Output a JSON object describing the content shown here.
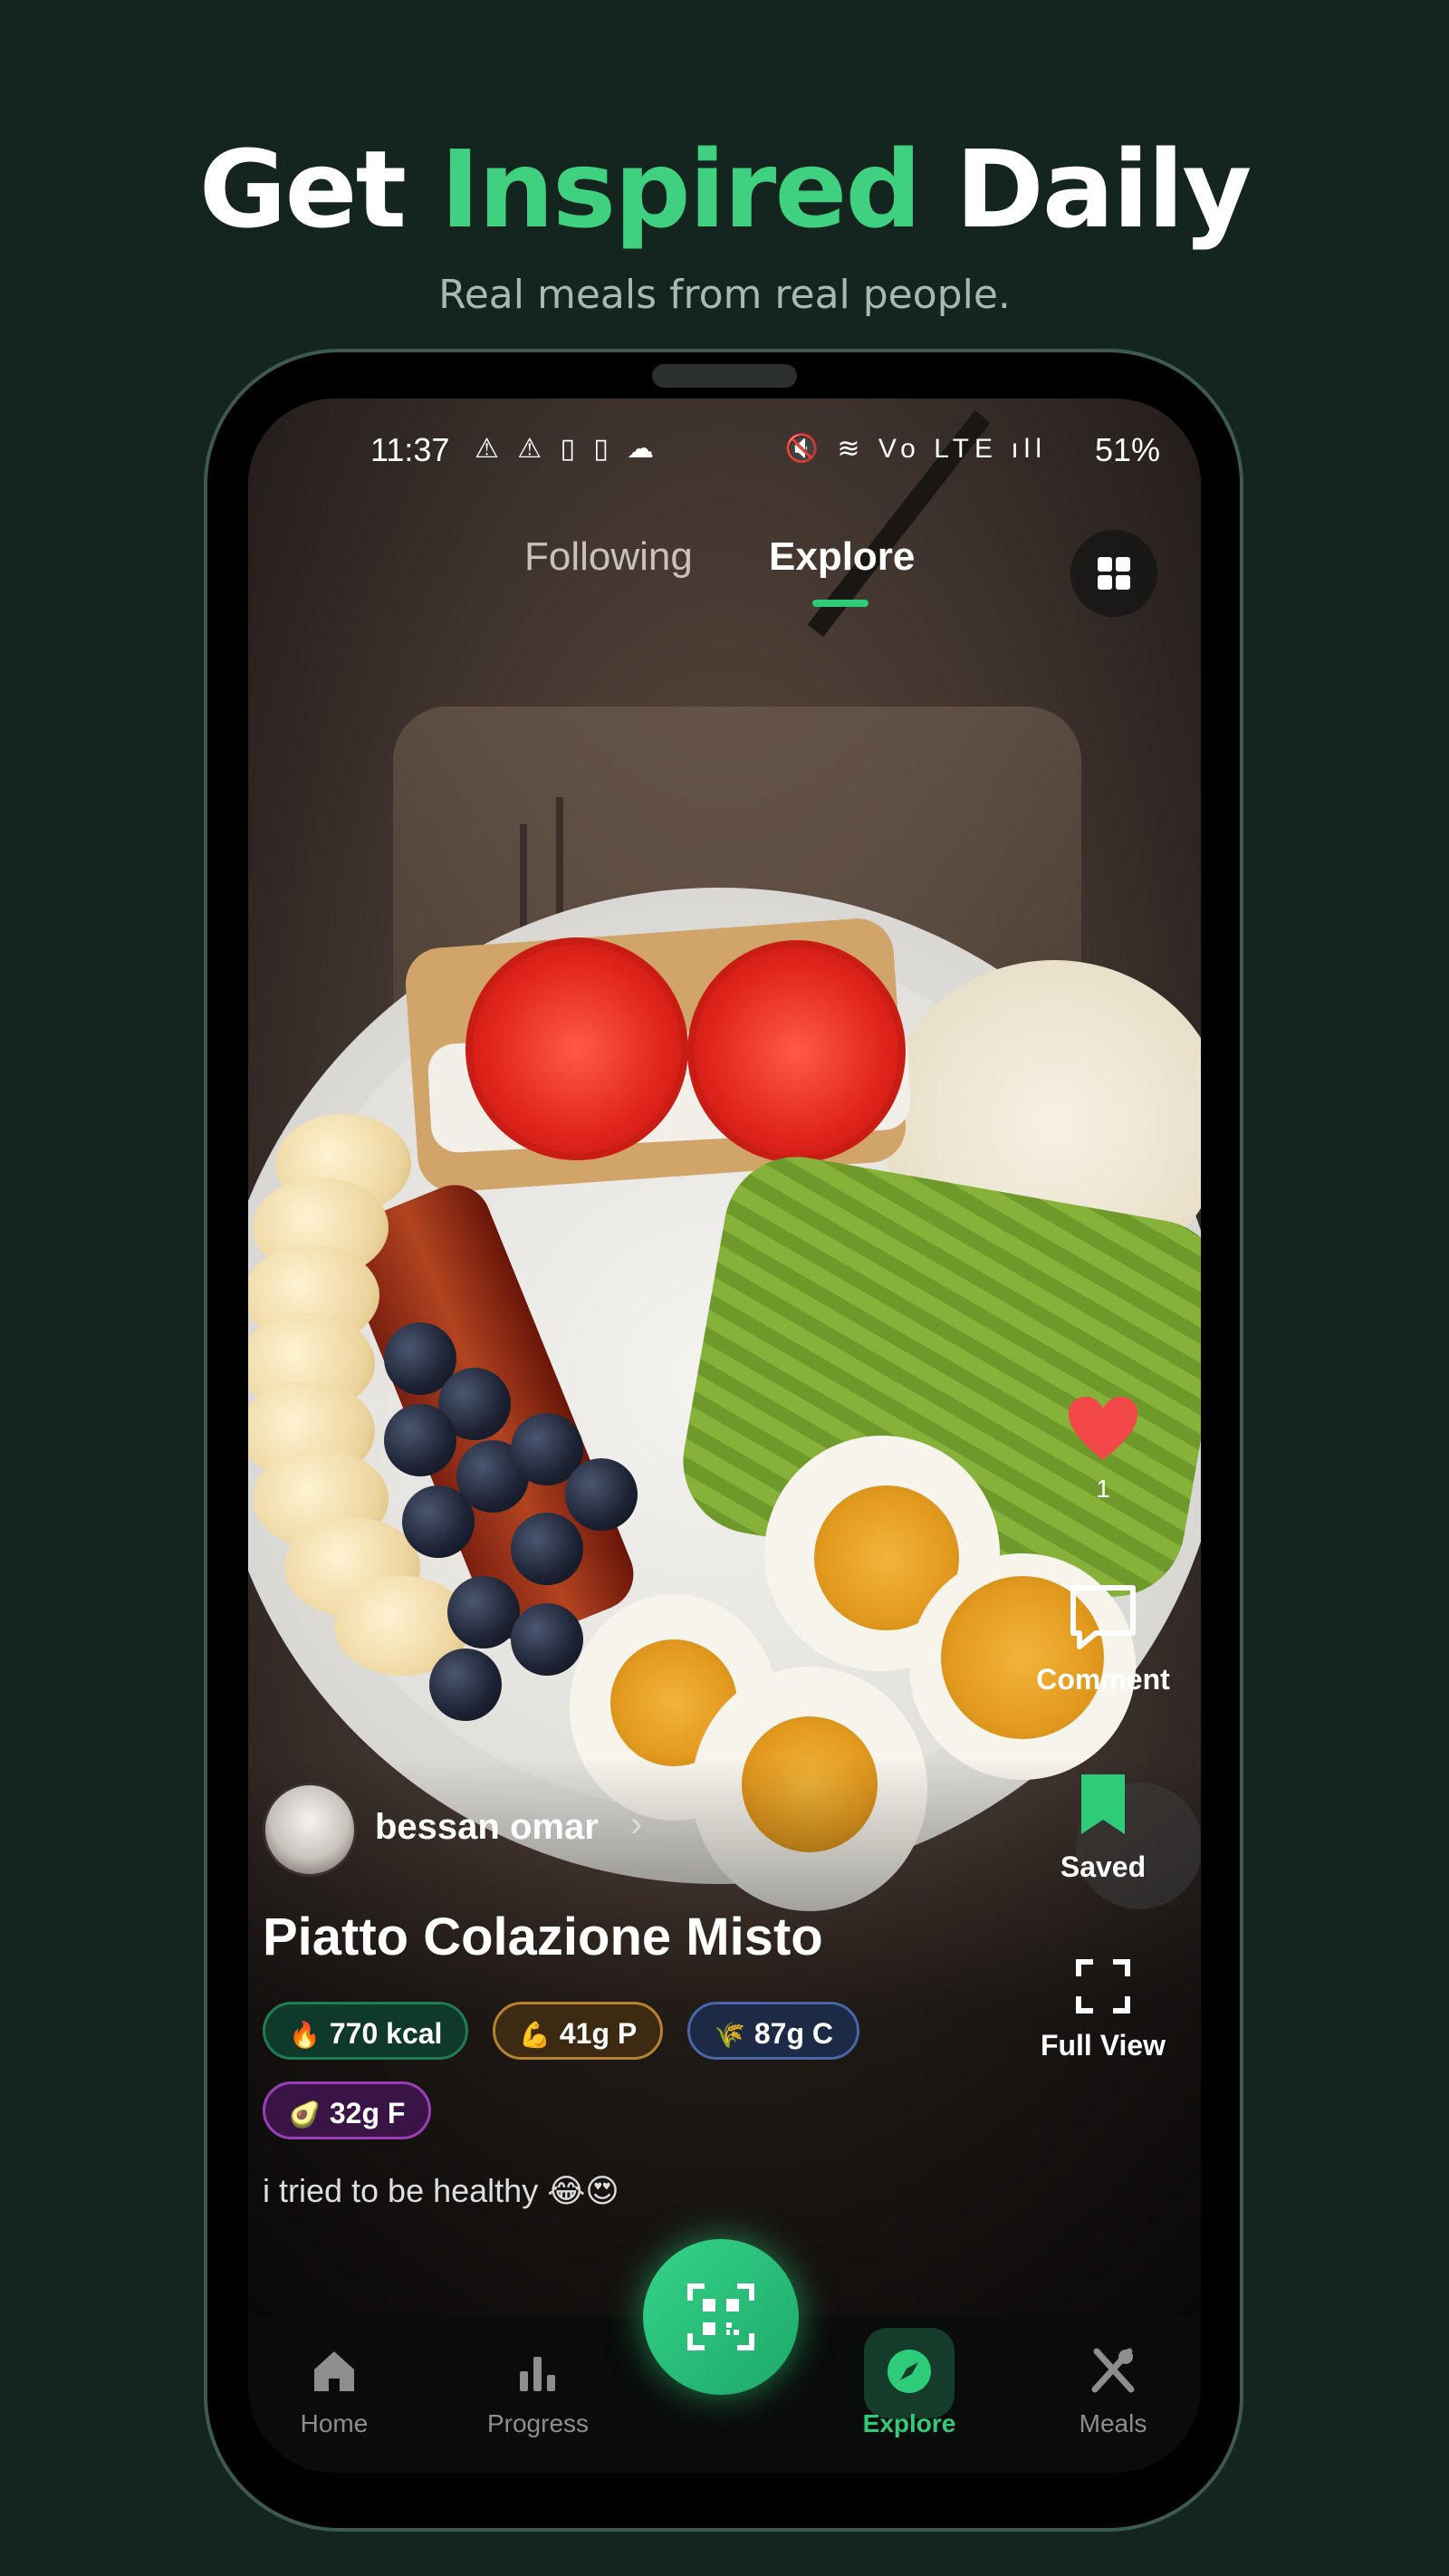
{
  "headline": {
    "part1": "Get",
    "accent": "Inspired",
    "part2": "Daily"
  },
  "subline": "Real meals from real people.",
  "status": {
    "time": "11:37",
    "left_icons": "⚠ ⚠ ▯ ▯ ☁",
    "right_icons": "🔇 ≋ Vo LTE ıll",
    "battery": "51%"
  },
  "tabs": [
    {
      "label": "Following",
      "active": false
    },
    {
      "label": "Explore",
      "active": true
    }
  ],
  "post": {
    "author": "bessan omar",
    "title": "Piatto Colazione Misto",
    "caption": "i tried to be healthy 😂😍",
    "chips": [
      {
        "icon": "🔥",
        "text": "770 kcal"
      },
      {
        "icon": "💪",
        "text": "41g P"
      },
      {
        "icon": "🌾",
        "text": "87g C"
      },
      {
        "icon": "🥑",
        "text": "32g F"
      }
    ]
  },
  "actions": {
    "likes": "1",
    "comment": "Comment",
    "saved": "Saved",
    "full_view": "Full View"
  },
  "nav": [
    {
      "label": "Home",
      "icon": "home-icon"
    },
    {
      "label": "Progress",
      "icon": "bar-chart-icon"
    },
    {
      "label": "Explore",
      "icon": "compass-icon",
      "active": true
    },
    {
      "label": "Meals",
      "icon": "utensils-icon"
    }
  ],
  "colors": {
    "accent": "#3fd17f",
    "background": "#14241e",
    "like": "#f24848"
  }
}
